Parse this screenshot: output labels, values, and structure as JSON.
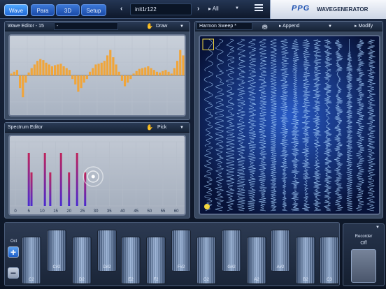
{
  "top_bar": {
    "tabs": [
      {
        "label": "Wave",
        "active": true
      },
      {
        "label": "Para",
        "active": false
      },
      {
        "label": "3D",
        "active": false
      },
      {
        "label": "Setup",
        "active": false
      }
    ],
    "prev_arrow": "‹",
    "next_arrow": "›",
    "preset_name": "init1r122",
    "filter_label": "▸ All",
    "filter_dropdown": "▼",
    "menu_icon": "hamburger-menu-icon"
  },
  "brand": {
    "logo": "PPG",
    "product": "WAVEGENERATOR"
  },
  "wave_editor": {
    "title": "Wave Editor - 15",
    "field": "-",
    "tool_icon": "hand-icon",
    "tool": "Draw",
    "dropdown": "▼",
    "values": [
      0.05,
      0.1,
      0.15,
      -0.35,
      -0.6,
      -0.2,
      0.08,
      0.2,
      0.3,
      0.4,
      0.45,
      0.42,
      0.35,
      0.3,
      0.25,
      0.28,
      0.3,
      0.32,
      0.25,
      0.2,
      0.15,
      -0.1,
      -0.25,
      -0.45,
      -0.35,
      -0.2,
      -0.1,
      0.1,
      0.2,
      0.3,
      0.32,
      0.35,
      0.4,
      0.55,
      0.7,
      0.5,
      0.3,
      0.1,
      -0.15,
      -0.3,
      -0.2,
      -0.1,
      0.05,
      0.12,
      0.18,
      0.2,
      0.22,
      0.25,
      0.2,
      0.15,
      0.1,
      0.08,
      0.12,
      0.15,
      0.1,
      0.05,
      0.2,
      0.4,
      0.7,
      0.55
    ]
  },
  "spectrum_editor": {
    "title": "Spectrum Editor",
    "tool_icon": "hand-icon",
    "tool": "Pick",
    "dropdown": "▼",
    "axis_ticks": [
      "0",
      "5",
      "10",
      "15",
      "20",
      "25",
      "30",
      "35",
      "40",
      "45",
      "50",
      "55",
      "60"
    ],
    "harmonics": [
      {
        "n": 5,
        "amp": 0.95
      },
      {
        "n": 6,
        "amp": 0.6
      },
      {
        "n": 11,
        "amp": 0.95
      },
      {
        "n": 13,
        "amp": 0.6
      },
      {
        "n": 17,
        "amp": 0.95
      },
      {
        "n": 20,
        "amp": 0.6
      },
      {
        "n": 23,
        "amp": 0.95
      },
      {
        "n": 26,
        "amp": 0.6
      }
    ]
  },
  "wavetable": {
    "title": "Harmon Sweep *",
    "action_icon": "save-icon",
    "action": "▸ Append",
    "action_dropdown": "▼",
    "modify": "▸ Modify"
  },
  "keyboard": {
    "oct_label": "Oct",
    "oct_up": "+",
    "oct_down": "−",
    "keys": [
      {
        "label": "C2",
        "black": false
      },
      {
        "label": "C#2",
        "black": true
      },
      {
        "label": "D2",
        "black": false
      },
      {
        "label": "D#2",
        "black": true
      },
      {
        "label": "E2",
        "black": false
      },
      {
        "label": "F2",
        "black": false
      },
      {
        "label": "F#2",
        "black": true
      },
      {
        "label": "G2",
        "black": false
      },
      {
        "label": "G#2",
        "black": true
      },
      {
        "label": "A2",
        "black": false
      },
      {
        "label": "A#2",
        "black": true
      },
      {
        "label": "B2",
        "black": false
      },
      {
        "label": "C3",
        "black": false
      }
    ]
  },
  "recorder": {
    "title": "Recorder",
    "state": "Off",
    "arrow": "▼"
  },
  "colors": {
    "accent": "#2067d6",
    "wave_bar": "#f0a53a",
    "spectrum_bar_top": "#c0245a",
    "spectrum_bar_bottom": "#4a2ad0",
    "wavetable_bg": "#0d1f5c"
  }
}
